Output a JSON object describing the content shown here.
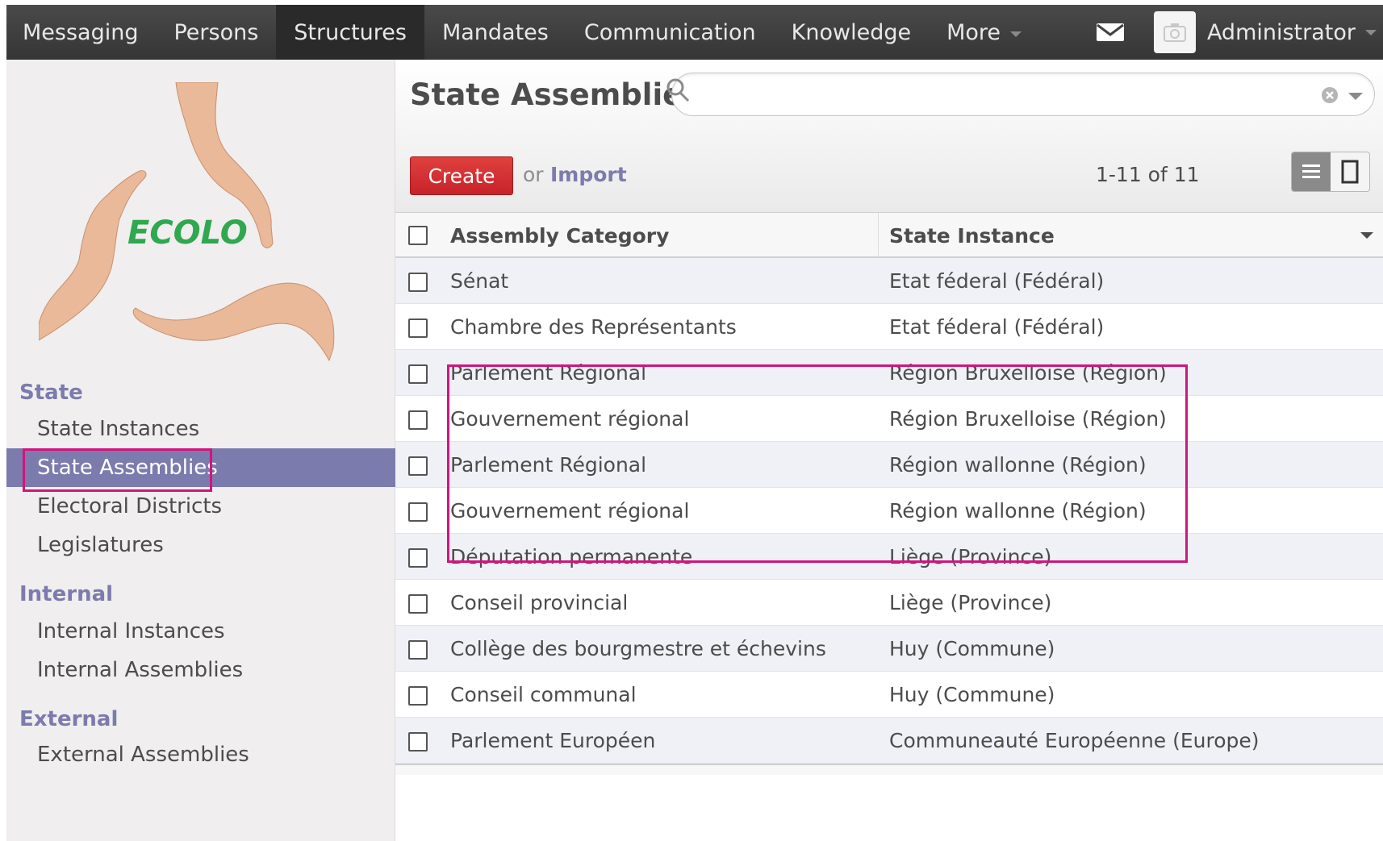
{
  "topnav": {
    "items": [
      "Messaging",
      "Persons",
      "Structures",
      "Mandates",
      "Communication",
      "Knowledge",
      "More"
    ],
    "active": "Structures",
    "user": "Administrator"
  },
  "sidebar": {
    "logo_text": "ECOLO",
    "sections": [
      {
        "title": "State",
        "items": [
          "State Instances",
          "State Assemblies",
          "Electoral Districts",
          "Legislatures"
        ]
      },
      {
        "title": "Internal",
        "items": [
          "Internal Instances",
          "Internal Assemblies"
        ]
      },
      {
        "title": "External",
        "items": [
          "External Assemblies"
        ]
      }
    ],
    "active_item": "State Assemblies"
  },
  "main": {
    "title": "State Assemblies",
    "search": {
      "placeholder": "",
      "value": ""
    },
    "create_label": "Create",
    "or_label": "or",
    "import_label": "Import",
    "pager": "1-11 of 11"
  },
  "table": {
    "columns": [
      "Assembly Category",
      "State Instance"
    ],
    "rows": [
      [
        "Sénat",
        "Etat féderal (Fédéral)"
      ],
      [
        "Chambre des Représentants",
        "Etat féderal (Fédéral)"
      ],
      [
        "Parlement Régional",
        "Région Bruxelloise (Région)"
      ],
      [
        "Gouvernement régional",
        "Région Bruxelloise (Région)"
      ],
      [
        "Parlement Régional",
        "Région wallonne (Région)"
      ],
      [
        "Gouvernement régional",
        "Région wallonne (Région)"
      ],
      [
        "Députation permanente",
        "Liège (Province)"
      ],
      [
        "Conseil provincial",
        "Liège (Province)"
      ],
      [
        "Collège des bourgmestre et échevins",
        "Huy (Commune)"
      ],
      [
        "Conseil communal",
        "Huy (Commune)"
      ],
      [
        "Parlement Européen",
        "Communeauté Européenne (Europe)"
      ]
    ]
  },
  "colors": {
    "accent": "#7c7bad",
    "highlight": "#d3147d",
    "create": "#d0302f",
    "topbar": "#414141"
  }
}
